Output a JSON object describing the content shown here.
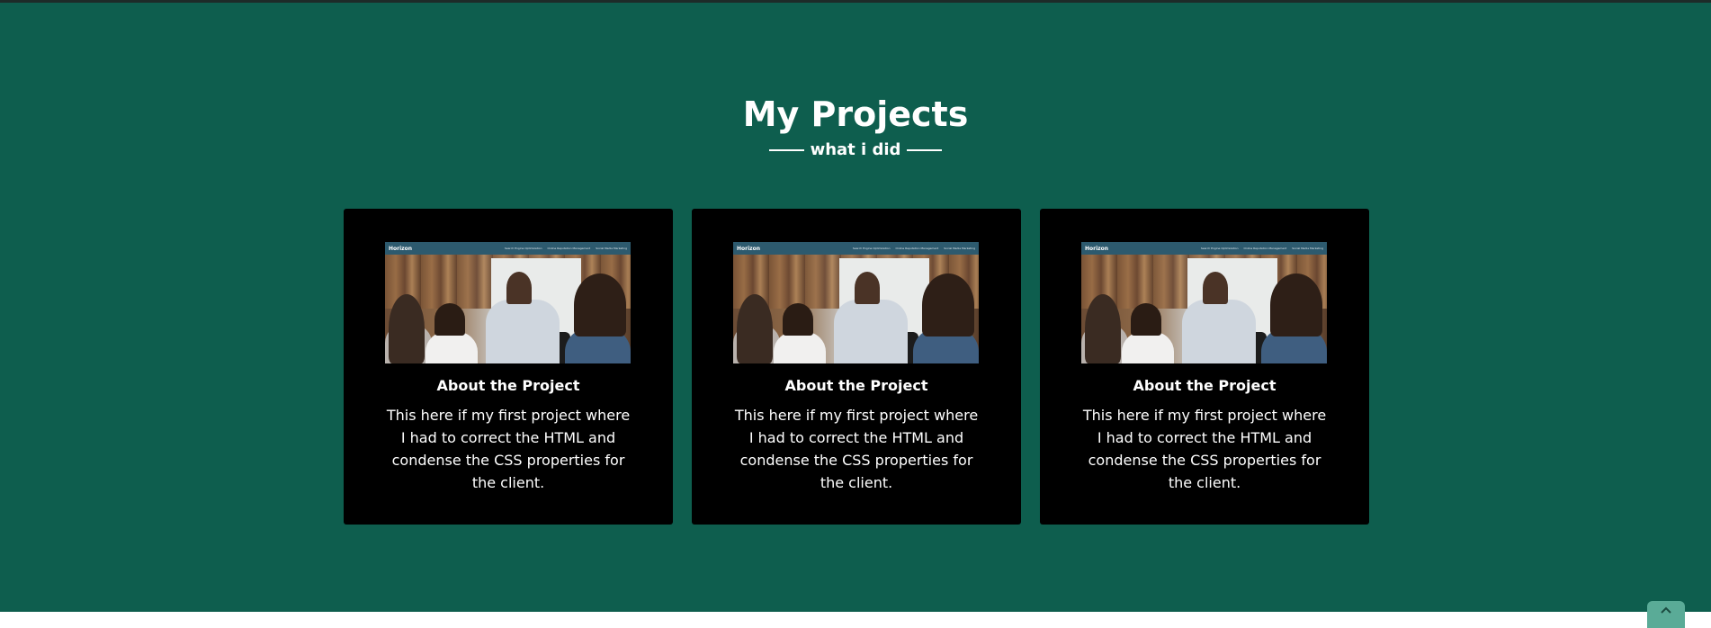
{
  "section": {
    "title": "My Projects",
    "subtitle": "what i did"
  },
  "projects": [
    {
      "heading": "About the Project",
      "description": "This here if my first project where I had to correct the HTML and condense the CSS properties for the client.",
      "thumbnail": {
        "brand": "Horizon",
        "links": [
          "Search Engine Optimization",
          "Online Reputation Management",
          "Social Media Marketing"
        ]
      }
    },
    {
      "heading": "About the Project",
      "description": "This here if my first project where I had to correct the HTML and condense the CSS properties for the client.",
      "thumbnail": {
        "brand": "Horizon",
        "links": [
          "Search Engine Optimization",
          "Online Reputation Management",
          "Social Media Marketing"
        ]
      }
    },
    {
      "heading": "About the Project",
      "description": "This here if my first project where I had to correct the HTML and condense the CSS properties for the client.",
      "thumbnail": {
        "brand": "Horizon",
        "links": [
          "Search Engine Optimization",
          "Online Reputation Management",
          "Social Media Marketing"
        ]
      }
    }
  ],
  "scroll_top": {
    "icon": "chevron-up-icon"
  },
  "colors": {
    "section_background": "#0e5e4e",
    "card_background": "#000000",
    "text": "#ffffff",
    "scroll_button": "#5aab97"
  }
}
